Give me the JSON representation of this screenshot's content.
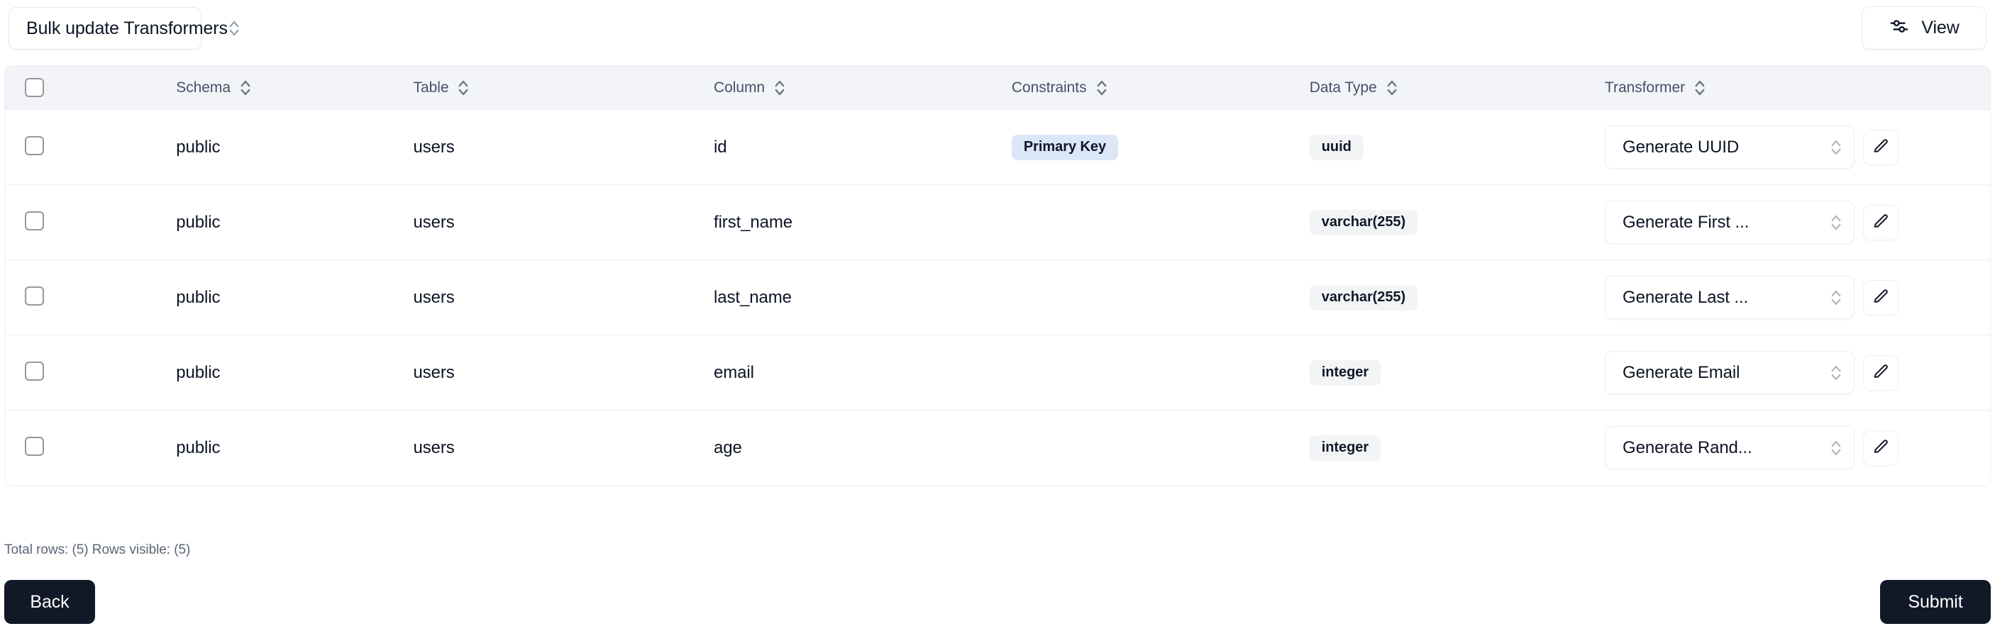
{
  "toolbar": {
    "bulk_update_label": "Bulk update Transformers",
    "view_label": "View",
    "view_icon": "sliders-icon",
    "bulk_chevron_icon": "chevron-up-down-icon"
  },
  "table": {
    "select_all_icon": "checkbox-unchecked-icon",
    "sort_icon": "chevron-up-down-icon",
    "columns": [
      {
        "key": "schema",
        "label": "Schema"
      },
      {
        "key": "table",
        "label": "Table"
      },
      {
        "key": "column",
        "label": "Column"
      },
      {
        "key": "constraints",
        "label": "Constraints"
      },
      {
        "key": "data_type",
        "label": "Data Type"
      },
      {
        "key": "transformer",
        "label": "Transformer"
      }
    ],
    "rows": [
      {
        "checkbox_icon": "checkbox-unchecked-icon",
        "schema": "public",
        "table": "users",
        "column": "id",
        "constraint": "Primary Key",
        "data_type": "uuid",
        "transformer": "Generate UUID",
        "transformer_chevron_icon": "chevron-up-down-icon",
        "edit_icon": "pencil-icon"
      },
      {
        "checkbox_icon": "checkbox-unchecked-icon",
        "schema": "public",
        "table": "users",
        "column": "first_name",
        "constraint": "",
        "data_type": "varchar(255)",
        "transformer": "Generate First ...",
        "transformer_chevron_icon": "chevron-up-down-icon",
        "edit_icon": "pencil-icon"
      },
      {
        "checkbox_icon": "checkbox-unchecked-icon",
        "schema": "public",
        "table": "users",
        "column": "last_name",
        "constraint": "",
        "data_type": "varchar(255)",
        "transformer": "Generate Last ...",
        "transformer_chevron_icon": "chevron-up-down-icon",
        "edit_icon": "pencil-icon"
      },
      {
        "checkbox_icon": "checkbox-unchecked-icon",
        "schema": "public",
        "table": "users",
        "column": "email",
        "constraint": "",
        "data_type": "integer",
        "transformer": "Generate Email",
        "transformer_chevron_icon": "chevron-up-down-icon",
        "edit_icon": "pencil-icon"
      },
      {
        "checkbox_icon": "checkbox-unchecked-icon",
        "schema": "public",
        "table": "users",
        "column": "age",
        "constraint": "",
        "data_type": "integer",
        "transformer": "Generate Rand...",
        "transformer_chevron_icon": "chevron-up-down-icon",
        "edit_icon": "pencil-icon"
      }
    ]
  },
  "footer": {
    "row_count_text": "Total rows: (5) Rows visible: (5)",
    "back_label": "Back",
    "submit_label": "Submit"
  },
  "colors": {
    "header_bg": "#f2f4f7",
    "primary_key_badge_bg": "#dbe6f7",
    "type_badge_bg": "#f3f4f6",
    "button_dark": "#111827",
    "border": "#e9edf3"
  }
}
